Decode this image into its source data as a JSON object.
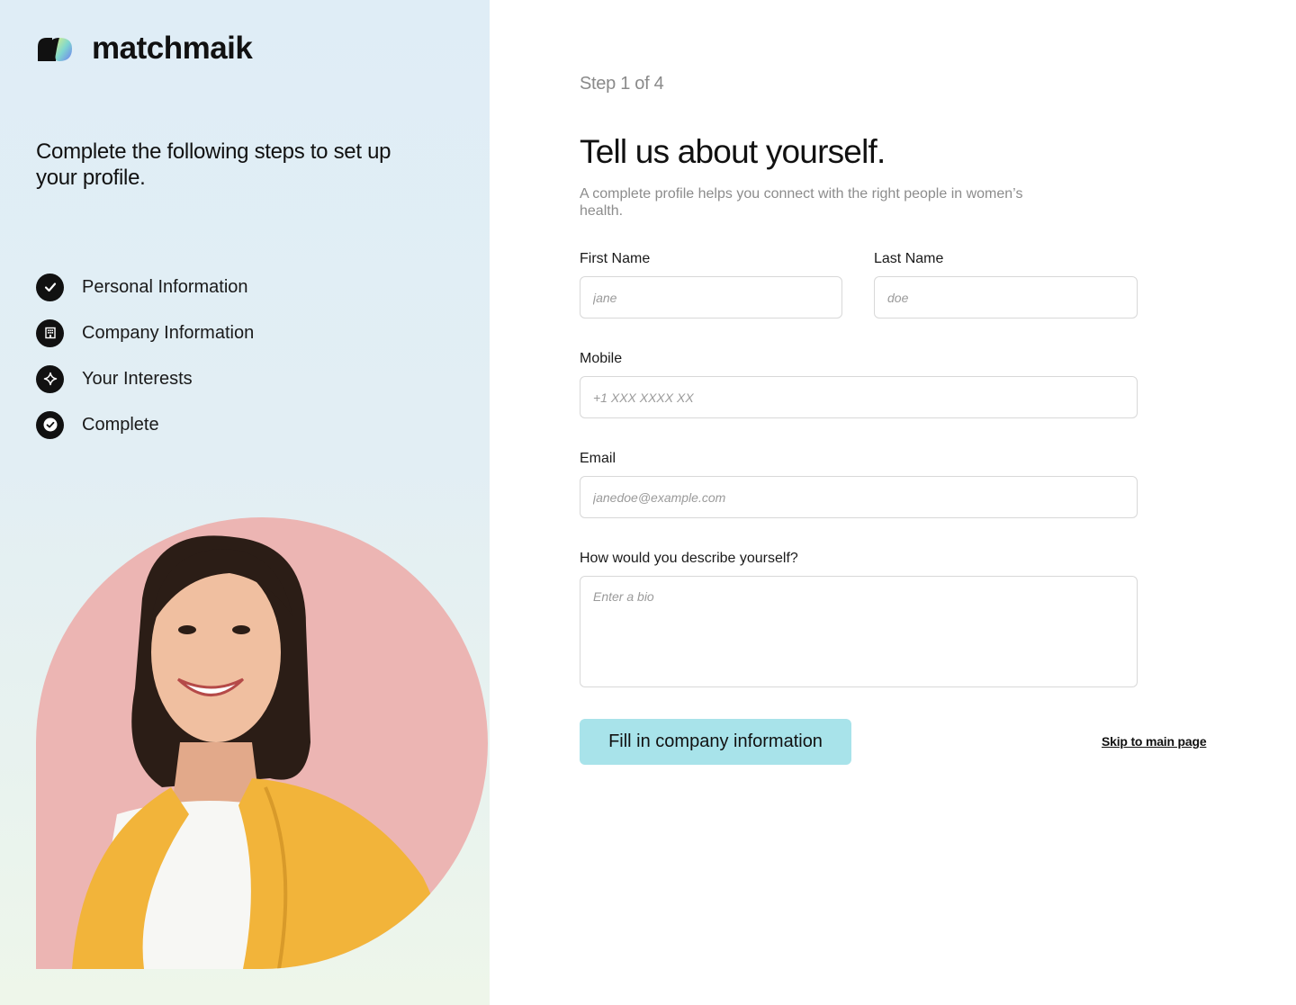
{
  "brand": {
    "name": "matchmaik"
  },
  "sidebar": {
    "intro": "Complete the following steps to set up your profile.",
    "steps": [
      {
        "label": "Personal Information",
        "icon": "check-circle-icon"
      },
      {
        "label": "Company Information",
        "icon": "building-icon"
      },
      {
        "label": "Your Interests",
        "icon": "sparkle-icon"
      },
      {
        "label": "Complete",
        "icon": "check-badge-icon"
      }
    ]
  },
  "main": {
    "step_count": "Step 1 of 4",
    "title": "Tell us about yourself.",
    "subtitle": "A complete profile helps you connect with the right people in women’s health.",
    "first_name": {
      "label": "First Name",
      "placeholder": "jane"
    },
    "last_name": {
      "label": "Last Name",
      "placeholder": "doe"
    },
    "mobile": {
      "label": "Mobile",
      "placeholder": "+1 XXX XXXX XX"
    },
    "email": {
      "label": "Email",
      "placeholder": "janedoe@example.com"
    },
    "bio": {
      "label": "How would you describe yourself?",
      "placeholder": "Enter a bio"
    },
    "primary_button": "Fill in company information",
    "skip_link": "Skip to main page"
  },
  "colors": {
    "accent_button": "#a8e3ea",
    "photo_background": "#ecb5b3",
    "sidebar_top": "#dfedf6",
    "sidebar_bottom": "#eef6ea"
  }
}
